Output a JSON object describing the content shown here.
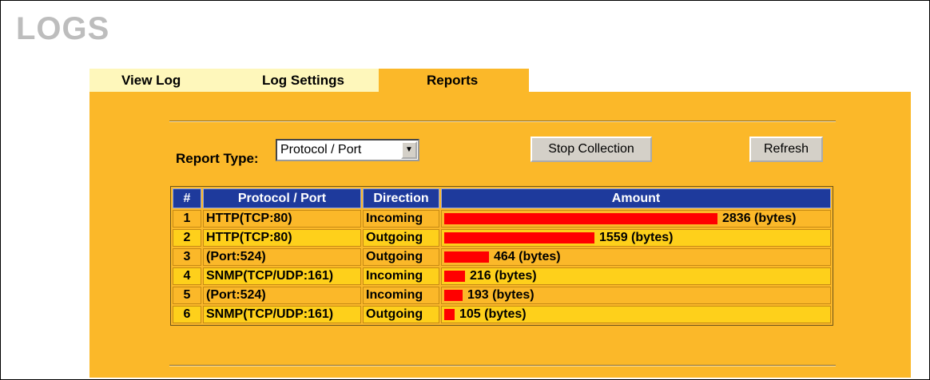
{
  "page": {
    "title": "LOGS"
  },
  "tabs": [
    {
      "label": "View Log"
    },
    {
      "label": "Log Settings"
    },
    {
      "label": "Reports"
    }
  ],
  "report_type": {
    "label": "Report Type:",
    "selected": "Protocol / Port"
  },
  "buttons": {
    "stop": "Stop Collection",
    "refresh": "Refresh"
  },
  "table": {
    "headers": [
      "#",
      "Protocol / Port",
      "Direction",
      "Amount"
    ],
    "rows": [
      {
        "num": "1",
        "protocol": "HTTP(TCP:80)",
        "direction": "Incoming",
        "amount": "2836 (bytes)",
        "bytes": 2836
      },
      {
        "num": "2",
        "protocol": "HTTP(TCP:80)",
        "direction": "Outgoing",
        "amount": "1559 (bytes)",
        "bytes": 1559
      },
      {
        "num": "3",
        "protocol": "(Port:524)",
        "direction": "Outgoing",
        "amount": "464 (bytes)",
        "bytes": 464
      },
      {
        "num": "4",
        "protocol": "SNMP(TCP/UDP:161)",
        "direction": "Incoming",
        "amount": "216 (bytes)",
        "bytes": 216
      },
      {
        "num": "5",
        "protocol": "(Port:524)",
        "direction": "Incoming",
        "amount": "193 (bytes)",
        "bytes": 193
      },
      {
        "num": "6",
        "protocol": "SNMP(TCP/UDP:161)",
        "direction": "Outgoing",
        "amount": "105 (bytes)",
        "bytes": 105
      }
    ]
  },
  "colors": {
    "panel": "#fbb829",
    "header": "#1e3a9c",
    "bar": "#ff0000",
    "row_alt": "#fed01b"
  }
}
